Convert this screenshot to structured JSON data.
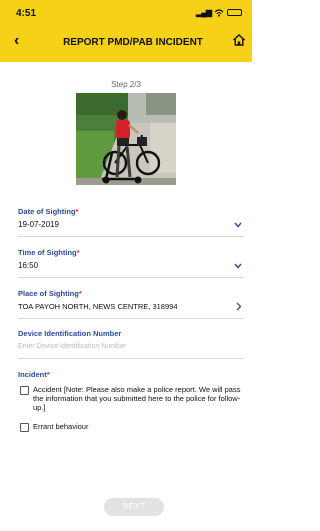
{
  "status_bar": {
    "time": "4:51",
    "signal": "▂▄▆"
  },
  "header": {
    "title": "REPORT PMD/PAB INCIDENT",
    "back_glyph": "‹"
  },
  "step": "Step 2/3",
  "form": {
    "date": {
      "label": "Date of Sighting",
      "value": "19-07-2019"
    },
    "time": {
      "label": "Time of Sighting",
      "value": "16:50"
    },
    "place": {
      "label": "Place of Sighting",
      "value": "TOA PAYOH NORTH, NEWS CENTRE, 318994"
    },
    "device": {
      "label": "Device Identification Number",
      "placeholder": "Enter Device Identification Number"
    },
    "incident": {
      "label": "Incident",
      "options": [
        "Accident [Note: Please also make a police report. We will pass the information that you submitted here to the police for follow-up.]",
        "Errant behaviour"
      ]
    }
  },
  "next_label": "NEXT",
  "required_mark": "*",
  "icons": {
    "home": "home-icon",
    "back": "back-arrow-icon",
    "chevron_down": "chevron-down-icon",
    "chevron_right": "chevron-right-icon"
  },
  "colors": {
    "header": "#f7d117",
    "label": "#2b4a9a",
    "required": "#d22222"
  }
}
